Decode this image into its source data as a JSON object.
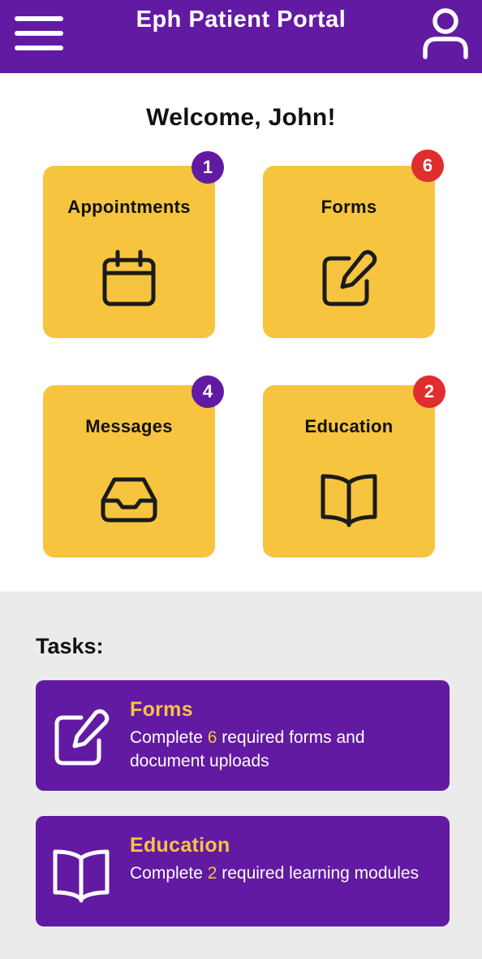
{
  "header": {
    "title": "Eph Patient Portal",
    "menu_icon": "hamburger-menu-icon",
    "profile_icon": "user-profile-icon",
    "background_color": "#631aa3"
  },
  "welcome": "Welcome, John!",
  "tiles": [
    {
      "label": "Appointments",
      "badge": "1",
      "badge_color": "#631aa3",
      "icon": "calendar-icon"
    },
    {
      "label": "Forms",
      "badge": "6",
      "badge_color": "#e02d2d",
      "icon": "edit-form-icon"
    },
    {
      "label": "Messages",
      "badge": "4",
      "badge_color": "#631aa3",
      "icon": "inbox-tray-icon"
    },
    {
      "label": "Education",
      "badge": "2",
      "badge_color": "#e02d2d",
      "icon": "open-book-icon"
    }
  ],
  "tasks": {
    "title": "Tasks:",
    "items": [
      {
        "title": "Forms",
        "desc_before": "Complete ",
        "count": "6",
        "desc_after": " required forms and document uploads",
        "icon": "edit-form-icon"
      },
      {
        "title": "Education",
        "desc_before": "Complete ",
        "count": "2",
        "desc_after": " required learning modules",
        "icon": "open-book-icon"
      }
    ]
  },
  "colors": {
    "accent_yellow": "#f6c43f",
    "brand_purple": "#631aa3",
    "alert_red": "#e02d2d",
    "tasks_background": "#ebebeb"
  }
}
